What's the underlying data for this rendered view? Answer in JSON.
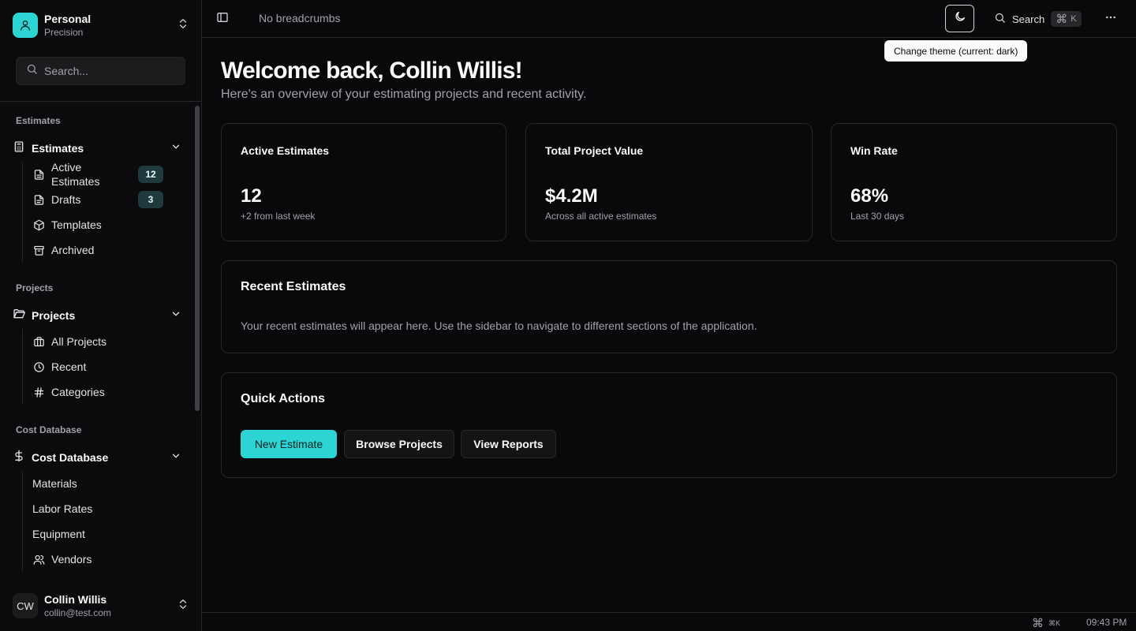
{
  "workspace": {
    "name": "Personal",
    "plan": "Precision"
  },
  "sidebar": {
    "search_placeholder": "Search...",
    "groups": [
      {
        "label": "Estimates",
        "title": "Estimates",
        "items": [
          {
            "label": "Active Estimates",
            "badge": "12",
            "icon": "file-text-icon"
          },
          {
            "label": "Drafts",
            "badge": "3",
            "icon": "file-icon"
          },
          {
            "label": "Templates",
            "icon": "box-icon"
          },
          {
            "label": "Archived",
            "icon": "archive-icon"
          }
        ]
      },
      {
        "label": "Projects",
        "title": "Projects",
        "items": [
          {
            "label": "All Projects",
            "icon": "briefcase-icon"
          },
          {
            "label": "Recent",
            "icon": "clock-icon"
          },
          {
            "label": "Categories",
            "icon": "hash-icon"
          }
        ]
      },
      {
        "label": "Cost Database",
        "title": "Cost Database",
        "items": [
          {
            "label": "Materials"
          },
          {
            "label": "Labor Rates"
          },
          {
            "label": "Equipment"
          },
          {
            "label": "Vendors",
            "icon": "users-icon"
          }
        ]
      }
    ]
  },
  "user": {
    "initials": "CW",
    "name": "Collin Willis",
    "email": "collin@test.com"
  },
  "topbar": {
    "breadcrumbs": "No breadcrumbs",
    "search_label": "Search",
    "search_shortcut": "⌘",
    "search_shortcut_key": "K",
    "theme_tooltip": "Change theme (current: dark)"
  },
  "main": {
    "welcome": "Welcome back, Collin Willis!",
    "subtitle": "Here's an overview of your estimating projects and recent activity.",
    "stats": [
      {
        "title": "Active Estimates",
        "value": "12",
        "note": "+2 from last week"
      },
      {
        "title": "Total Project Value",
        "value": "$4.2M",
        "note": "Across all active estimates"
      },
      {
        "title": "Win Rate",
        "value": "68%",
        "note": "Last 30 days"
      }
    ],
    "recent": {
      "title": "Recent Estimates",
      "text": "Your recent estimates will appear here. Use the sidebar to navigate to different sections of the application."
    },
    "quick_actions": {
      "title": "Quick Actions",
      "buttons": [
        "New Estimate",
        "Browse Projects",
        "View Reports"
      ]
    }
  },
  "footer": {
    "shortcut_symbol": "⌘",
    "shortcut_key": "⌘K",
    "time": "09:43 PM"
  },
  "colors": {
    "accent": "#2dd4d4",
    "background": "#09090b",
    "border": "#27272a"
  }
}
